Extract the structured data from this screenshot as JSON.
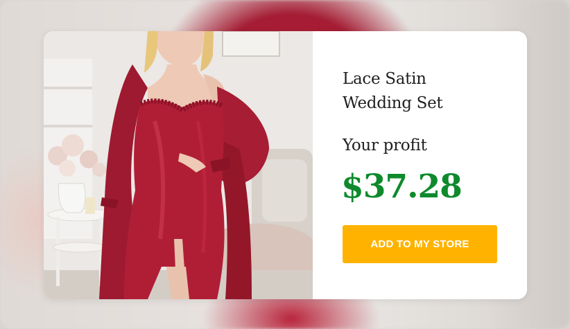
{
  "product": {
    "title_line1": "Lace Satin",
    "title_line2": "Wedding Set",
    "image_name": "red-satin-robe-set-photo"
  },
  "profit": {
    "label": "Your profit",
    "amount": "$37.28"
  },
  "cta": {
    "label": "ADD TO MY STORE"
  },
  "colors": {
    "price": "#0e8a2c",
    "cta_background": "#ffb300",
    "cta_text": "#ffffff",
    "product_red": "#b01e36"
  }
}
